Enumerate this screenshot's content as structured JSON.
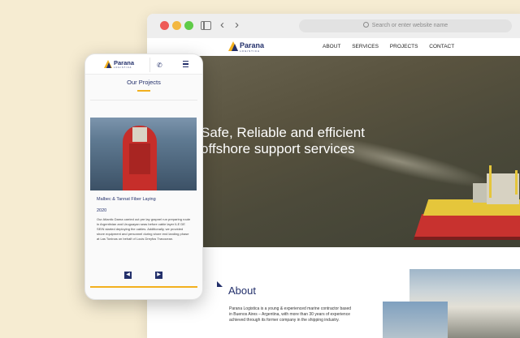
{
  "browser": {
    "address_placeholder": "Search or enter website name"
  },
  "site": {
    "logo_text": "Parana",
    "logo_subtext": "LOGISTICA",
    "nav": [
      "ABOUT",
      "SERVICES",
      "PROJECTS",
      "CONTACT"
    ],
    "hero_title": "Safe, Reliable and efficient offshore support services",
    "about_title": "About",
    "about_text": "Parana Logistica is a young & experienced marine contractor based in Buenos Aires – Argentina, with more than 30 years of experience achieved through its former company in the shipping industry."
  },
  "mobile": {
    "logo_text": "Parana",
    "logo_subtext": "LOGISTICA",
    "section_title": "Our Projects",
    "card_title": "Malbec & Tannat Fiber Laying",
    "card_year": "2020",
    "card_text": "Our Atlantic Dama carried out pre lay grapnel run preparing route in Argentinian and Uruguayan seas before cable layer ILE DE SEIN started deploying the cables. Additionally, we provided shore equipment and personnel during shore end landing phase at Las Toninas on behalf of Louis Dreyfus Travocean.",
    "prev_icon": "◀",
    "next_icon": "▶"
  },
  "colors": {
    "brand_navy": "#23306b",
    "brand_gold": "#f2b01e",
    "background": "#f6ecd2"
  }
}
